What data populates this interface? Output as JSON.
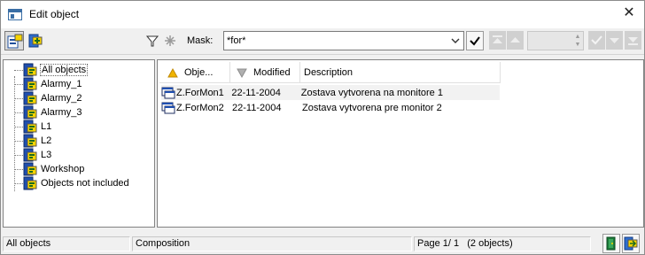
{
  "window": {
    "title": "Edit object"
  },
  "toolbar": {
    "mask_label": "Mask:",
    "mask_value": "*for*"
  },
  "tree": {
    "items": [
      {
        "label": "All objects",
        "selected": true
      },
      {
        "label": "Alarmy_1"
      },
      {
        "label": "Alarmy_2"
      },
      {
        "label": "Alarmy_3"
      },
      {
        "label": "L1"
      },
      {
        "label": "L2"
      },
      {
        "label": "L3"
      },
      {
        "label": "Workshop"
      },
      {
        "label": "Objects not included"
      }
    ]
  },
  "list": {
    "columns": [
      "Obje...",
      "Modified",
      "Description"
    ],
    "rows": [
      {
        "name": "Z.ForMon1",
        "modified": "22-11-2004",
        "description": "Zostava vytvorena na monitore 1"
      },
      {
        "name": "Z.ForMon2",
        "modified": "22-11-2004",
        "description": "Zostava vytvorena pre monitor 2"
      }
    ]
  },
  "status": {
    "filter": "All objects",
    "type": "Composition",
    "page": "Page  1/ 1",
    "count": "(2 objects)"
  }
}
